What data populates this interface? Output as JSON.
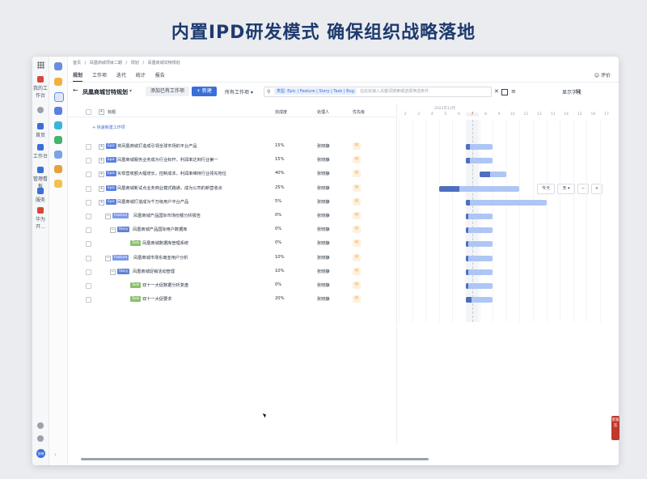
{
  "headline": "内置IPD研发模式 确保组织战略落地",
  "rail": {
    "items": [
      {
        "label": "",
        "icon": "apps-grid-icon"
      },
      {
        "label": "我的工作台",
        "icon": "huawei-logo-icon"
      },
      {
        "label": "",
        "icon": "location-icon"
      },
      {
        "label": "首页",
        "icon": "home-icon"
      },
      {
        "label": "工作台",
        "icon": "workbench-icon"
      },
      {
        "label": "管理看板",
        "icon": "dashboard-icon"
      },
      {
        "label": "服务",
        "icon": "service-icon"
      },
      {
        "label": "华为开...",
        "icon": "developer-icon"
      }
    ],
    "avatar": "张晓"
  },
  "breadcrumb": [
    "首页",
    "/",
    "凤凰商城项目二期",
    "/",
    "规划",
    "/",
    "凤凰商城甘特规划"
  ],
  "tabs": [
    "规划",
    "工作项",
    "迭代",
    "统计",
    "报告"
  ],
  "review_label": "评价",
  "toolbar": {
    "back": "←",
    "plan_title": "凤凰商城甘特规划",
    "caret": "▾",
    "add_existing": "添加已有工作项",
    "new_button": "+ 新建",
    "all_items": "所有工作项 ▾",
    "filter_tag": "类型: Epic | Feature | Story | Task | Bug",
    "filter_placeholder": "在此处输入关键词搜索或选择筛选条件",
    "show_fields": "显示字段"
  },
  "columns": {
    "title": "标题",
    "progress": "完成度",
    "owner": "处理人",
    "priority": "优先级"
  },
  "quick_add": "+ 快速新建工作项",
  "rows": [
    {
      "type": "Epic",
      "title": "将凤凰商城打造成引领全球市场的平台产品",
      "progress": "15%",
      "owner": "张晓静",
      "priority": "中"
    },
    {
      "type": "Epic",
      "title": "凤凰商城服务业务成为行业标杆，利润率达到行业第一",
      "progress": "15%",
      "owner": "张晓静",
      "priority": "中"
    },
    {
      "type": "Epic",
      "title": "实现营收额大幅增长，控制成本，利润率维持行业领先地位",
      "progress": "40%",
      "owner": "张晓静",
      "priority": "中"
    },
    {
      "type": "Epic",
      "title": "凤凰商城新试点业务商业模式跑通，成为公司的新营收点",
      "progress": "25%",
      "owner": "张晓静",
      "priority": "中"
    },
    {
      "type": "Epic",
      "title": "凤凰商城打造成为千万级用户平台产品",
      "progress": "5%",
      "owner": "张晓静",
      "priority": "中"
    },
    {
      "type": "Feature",
      "title": "凤凰商城产品国际市场份额分析报告",
      "progress": "0%",
      "owner": "张晓静",
      "priority": "中"
    },
    {
      "type": "Story",
      "title": "凤凰商城产品国际用户数据库",
      "progress": "0%",
      "owner": "张晓静",
      "priority": "中"
    },
    {
      "type": "Task",
      "title": "凤凰商城数据库管理系统",
      "progress": "0%",
      "owner": "张晓静",
      "priority": "中"
    },
    {
      "type": "Feature",
      "title": "凤凰商城市场东南亚用户分析",
      "progress": "10%",
      "owner": "张晓静",
      "priority": "中"
    },
    {
      "type": "Story",
      "title": "凤凰商城促销活动管理",
      "progress": "10%",
      "owner": "张晓静",
      "priority": "中"
    },
    {
      "type": "Task",
      "title": "双十一大促数据分析复盘",
      "progress": "0%",
      "owner": "张晓静",
      "priority": "中"
    },
    {
      "type": "Task",
      "title": "双十一大促要求",
      "progress": "20%",
      "owner": "张晓静",
      "priority": "中"
    }
  ],
  "gantt": {
    "month": "2022年12月",
    "days": [
      "2",
      "3",
      "4",
      "5",
      "6",
      "7",
      "8",
      "9",
      "10",
      "11",
      "12",
      "13",
      "14",
      "15",
      "16",
      "17"
    ],
    "today_day": "7",
    "today_label": "今天",
    "scale_label": "天 ▾",
    "zoom_out": "−",
    "zoom_in": "+",
    "bars": [
      {
        "start": 7.0,
        "end": 9.0,
        "done": 0.15
      },
      {
        "start": 7.0,
        "end": 9.0,
        "done": 0.15
      },
      {
        "start": 8.0,
        "end": 10.0,
        "done": 0.4
      },
      {
        "start": 5.0,
        "end": 11.0,
        "done": 0.25
      },
      {
        "start": 7.0,
        "end": 13.0,
        "done": 0.05
      },
      {
        "start": 7.0,
        "end": 9.0,
        "done": 0
      },
      {
        "start": 7.0,
        "end": 9.0,
        "done": 0
      },
      {
        "start": 7.0,
        "end": 9.0,
        "done": 0
      },
      {
        "start": 7.0,
        "end": 9.0,
        "done": 0.1
      },
      {
        "start": 7.0,
        "end": 9.0,
        "done": 0.1
      },
      {
        "start": 7.0,
        "end": 9.0,
        "done": 0
      },
      {
        "start": 7.0,
        "end": 9.0,
        "done": 0.2
      }
    ]
  },
  "side_tab": "客服 答"
}
